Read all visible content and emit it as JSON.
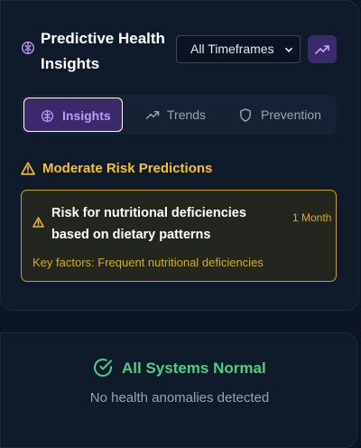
{
  "header": {
    "title": "Predictive Health Insights",
    "timeframe_select": {
      "selected": "All Timeframes"
    },
    "trend_button_icon": "trending-up-icon"
  },
  "tabs": [
    {
      "label": "Insights",
      "icon": "brain-icon",
      "active": true
    },
    {
      "label": "Trends",
      "icon": "trending-up-icon",
      "active": false
    },
    {
      "label": "Prevention",
      "icon": "shield-icon",
      "active": false
    }
  ],
  "risk_section": {
    "title": "Moderate Risk Predictions",
    "predictions": [
      {
        "title": "Risk for nutritional deficiencies based on dietary patterns",
        "timeframe": "1 Month",
        "factors": "Key factors: Frequent nutritional deficiencies"
      }
    ]
  },
  "status_card": {
    "title": "All Systems Normal",
    "subtitle": "No health anomalies detected"
  },
  "colors": {
    "background": "#0b1524",
    "card": "#0f1a2b",
    "accent_purple": "#3b2a6b",
    "accent_purple_text": "#b99cf5",
    "warning": "#f5c426",
    "success": "#4ad284"
  }
}
